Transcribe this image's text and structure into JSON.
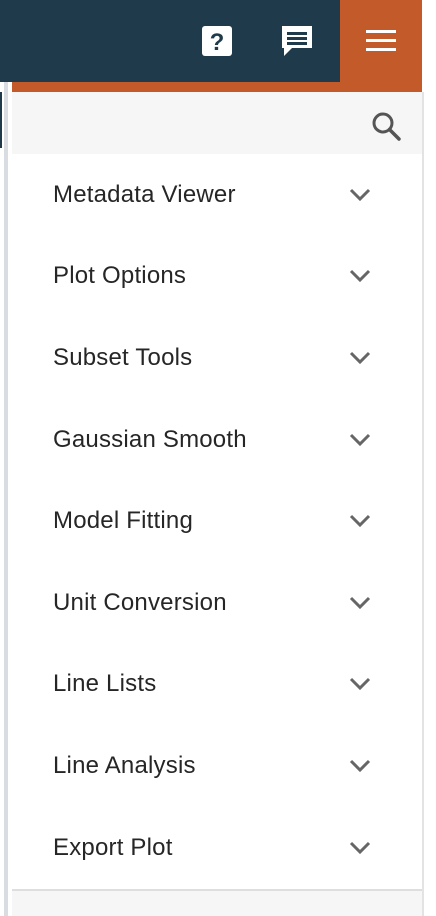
{
  "toolbar": {
    "background_color": "#1f3a4a",
    "accent_color": "#c25a2a",
    "help_icon": "help-box-icon",
    "help_glyph": "?",
    "feedback_icon": "comment-icon",
    "menu_icon": "hamburger-menu-icon"
  },
  "tray": {
    "search_icon": "magnifier-icon",
    "chevron_icon": "chevron-down-icon",
    "plugins": [
      {
        "label": "Metadata Viewer"
      },
      {
        "label": "Plot Options"
      },
      {
        "label": "Subset Tools"
      },
      {
        "label": "Gaussian Smooth"
      },
      {
        "label": "Model Fitting"
      },
      {
        "label": "Unit Conversion"
      },
      {
        "label": "Line Lists"
      },
      {
        "label": "Line Analysis"
      },
      {
        "label": "Export Plot"
      }
    ]
  }
}
